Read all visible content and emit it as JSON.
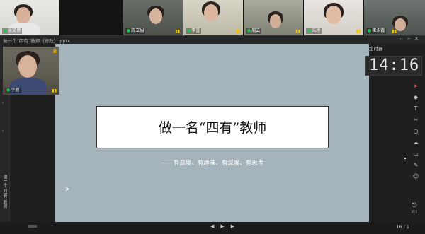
{
  "window": {
    "title": "做一个“四有”教师（修改）.pptx",
    "timer_label": "定时器"
  },
  "participants": [
    {
      "name": "张文博"
    },
    {
      "name": "陈立娟"
    },
    {
      "name": "李雪"
    },
    {
      "name": "周云"
    },
    {
      "name": "朱婷"
    },
    {
      "name": "崔永霞"
    }
  ],
  "self": {
    "name": "李丽"
  },
  "left_panel": {
    "vertical_label": "做一个“四有”教师"
  },
  "slide": {
    "title": "做一名“四有”教师",
    "subtitle": "——有温度、有趣味、有深度、有思考"
  },
  "timer": {
    "digits": "14:16"
  },
  "toolbar": {
    "items": [
      "pointer",
      "eraser",
      "text",
      "scissors",
      "shape",
      "cloud",
      "board",
      "note",
      "user"
    ],
    "bottom_label": "退出"
  },
  "bottombar": {
    "slide_number": "16 / 1"
  },
  "colors": {
    "slide_bg": "#a5b4bb",
    "accent_active": "#e05a5a",
    "mic_green": "#27c24c",
    "signal_yellow": "#f6c400"
  }
}
